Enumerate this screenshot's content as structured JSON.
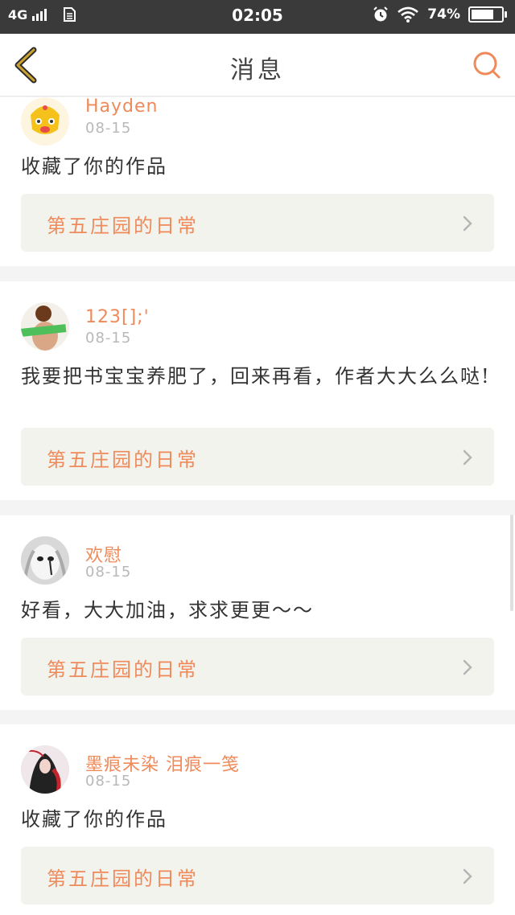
{
  "status_bar": {
    "network": "4G",
    "time": "02:05",
    "battery": "74%",
    "battery_level": 0.74
  },
  "nav": {
    "title": "消息",
    "back_icon": "chevron-left-icon",
    "search_icon": "search-icon"
  },
  "messages": [
    {
      "user": "Hayden",
      "date": "08-15",
      "text": "收藏了你的作品",
      "work_title": "第五庄园的日常"
    },
    {
      "user": "123[];'",
      "date": "08-15",
      "text": "我要把书宝宝养肥了，回来再看，作者大大么么哒!",
      "work_title": "第五庄园的日常"
    },
    {
      "user": "欢慰",
      "date": "08-15",
      "text": "好看，大大加油，求求更更～～",
      "work_title": "第五庄园的日常"
    },
    {
      "user": "墨痕未染 泪痕一笺",
      "date": "08-15",
      "text": "收藏了你的作品",
      "work_title": "第五庄园的日常"
    }
  ],
  "colors": {
    "accent": "#ef8a5a",
    "back_icon": "#c9a233",
    "status_bar_bg": "#3a3a3a",
    "work_card_bg": "#f3f3ee"
  }
}
